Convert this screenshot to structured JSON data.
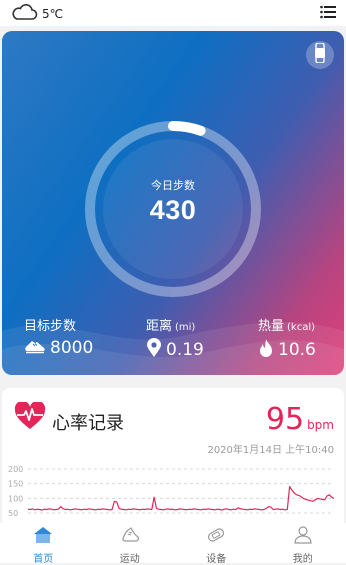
{
  "weather": {
    "icon": "cloud-icon",
    "temperature": "5℃"
  },
  "header": {
    "menu_icon": "list-menu-icon"
  },
  "hero": {
    "band_icon": "smart-band-icon",
    "ring_progress": 0.054,
    "today_steps_label": "今日步数",
    "today_steps_value": "430",
    "stats": {
      "steps": {
        "label": "目标步数",
        "unit": "",
        "value": "8000",
        "icon": "shoe-icon"
      },
      "distance": {
        "label": "距离",
        "unit": "(mi)",
        "value": "0.19",
        "icon": "location-pin-icon"
      },
      "calories": {
        "label": "热量",
        "unit": "(kcal)",
        "value": "10.6",
        "icon": "flame-icon"
      }
    },
    "colors": {
      "gradient_start": "#2e79c3",
      "gradient_end": "#e0407a"
    }
  },
  "heart_rate": {
    "title": "心率记录",
    "icon": "heart-pulse-icon",
    "value": "95",
    "unit": "bpm",
    "timestamp": "2020年1月14日 上午10:40",
    "accent": "#e4255a",
    "chart_data": {
      "type": "line",
      "y_ticks": [
        "200",
        "150",
        "100",
        "50"
      ],
      "ylim": [
        40,
        210
      ],
      "grid": "dashed",
      "series": [
        {
          "name": "",
          "values": [
            63,
            62,
            64,
            61,
            63,
            62,
            60,
            63,
            62,
            64,
            63,
            61,
            62,
            63,
            72,
            65,
            62,
            63,
            61,
            62,
            64,
            63,
            62,
            61,
            63,
            62,
            64,
            63,
            62,
            61,
            63,
            62,
            64,
            63,
            62,
            61,
            62,
            90,
            88,
            65,
            63,
            62,
            61,
            63,
            62,
            64,
            63,
            62,
            61,
            63,
            62,
            64,
            63,
            62,
            104,
            66,
            63,
            62,
            61,
            63,
            64,
            62,
            63,
            61,
            62,
            64,
            63,
            62,
            61,
            63,
            62,
            64,
            63,
            62,
            61,
            63,
            62,
            64,
            63,
            62,
            61,
            63,
            62,
            60,
            63,
            64,
            62,
            61,
            63,
            62,
            68,
            64,
            63,
            62,
            61,
            63,
            62,
            64,
            63,
            62,
            61,
            62,
            66,
            72,
            70,
            62,
            63,
            64,
            62,
            63,
            61,
            62,
            140,
            128,
            118,
            112,
            110,
            105,
            100,
            96,
            94,
            92,
            90,
            95,
            100,
            98,
            96,
            95,
            108,
            112,
            104,
            100
          ]
        }
      ]
    }
  },
  "tabbar": {
    "items": [
      {
        "label": "首页",
        "icon": "home-icon",
        "active": true
      },
      {
        "label": "运动",
        "icon": "running-shoe-icon",
        "active": false
      },
      {
        "label": "设备",
        "icon": "band-device-icon",
        "active": false
      },
      {
        "label": "我的",
        "icon": "person-icon",
        "active": false
      }
    ],
    "active_color": "#2f88d8"
  }
}
